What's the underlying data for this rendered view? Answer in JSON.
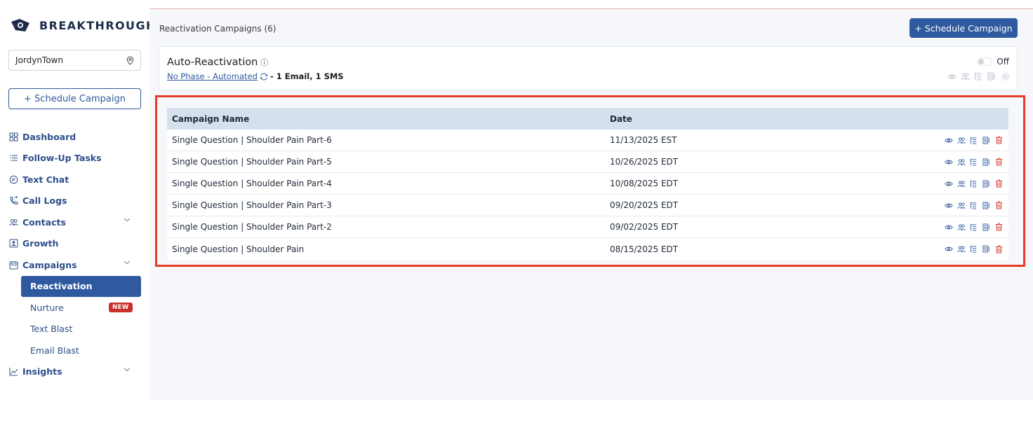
{
  "brand": {
    "name": "BREAKTHROUGH",
    "color": "#1c2b4a"
  },
  "sidebar": {
    "location": {
      "value": "JordynTown",
      "icon": "map-pin-icon"
    },
    "schedule_button": "+ Schedule Campaign",
    "items": [
      {
        "label": "Dashboard",
        "icon": "dashboard-icon"
      },
      {
        "label": "Follow-Up Tasks",
        "icon": "list-icon"
      },
      {
        "label": "Text Chat",
        "icon": "chat-icon"
      },
      {
        "label": "Call Logs",
        "icon": "phone-icon"
      },
      {
        "label": "Contacts",
        "icon": "contacts-icon",
        "expandable": true
      },
      {
        "label": "Growth",
        "icon": "growth-icon"
      },
      {
        "label": "Campaigns",
        "icon": "calendar-icon",
        "expandable": true,
        "expanded": true
      }
    ],
    "campaign_sub": [
      {
        "label": "Reactivation",
        "active": true
      },
      {
        "label": "Nurture",
        "badge": "NEW"
      },
      {
        "label": "Text Blast"
      },
      {
        "label": "Email Blast"
      }
    ],
    "insights": {
      "label": "Insights",
      "icon": "chart-icon",
      "expandable": true
    }
  },
  "main": {
    "title": "Reactivation Campaigns (6)",
    "schedule_button": "+ Schedule Campaign",
    "auto_reactivation": {
      "title": "Auto-Reactivation",
      "info_glyph": "ⓘ",
      "phase_link": "No Phase - Automated",
      "description": "- 1 Email, 1 SMS",
      "toggle_state": "Off"
    },
    "table": {
      "columns": [
        "Campaign Name",
        "Date"
      ],
      "rows": [
        {
          "name": "Single Question | Shoulder Pain Part-6",
          "date": "11/13/2025 EST"
        },
        {
          "name": "Single Question | Shoulder Pain Part-5",
          "date": "10/26/2025 EDT"
        },
        {
          "name": "Single Question | Shoulder Pain Part-4",
          "date": "10/08/2025 EDT"
        },
        {
          "name": "Single Question | Shoulder Pain Part-3",
          "date": "09/20/2025 EDT"
        },
        {
          "name": "Single Question | Shoulder Pain Part-2",
          "date": "09/02/2025 EDT"
        },
        {
          "name": "Single Question | Shoulder Pain",
          "date": "08/15/2025 EDT"
        }
      ],
      "row_actions": [
        "view-icon",
        "audience-icon",
        "flow-icon",
        "report-icon",
        "delete-icon"
      ]
    }
  },
  "colors": {
    "primary": "#2f5aa0",
    "highlight": "#e83a2b",
    "badge": "#c9302c",
    "delete": "#d9352a"
  }
}
